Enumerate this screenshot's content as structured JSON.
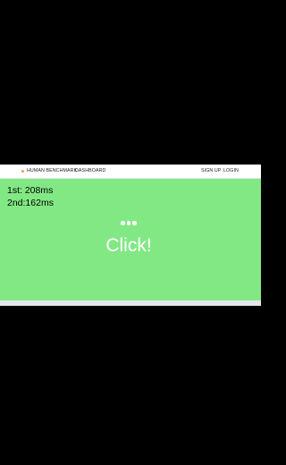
{
  "nav": {
    "brand": "HUMAN BENCHMARK",
    "dashboard": "DASHBOARD",
    "signup": "SIGN UP",
    "login": "LOGIN",
    "logo_icon": "lightning-bolt-icon"
  },
  "results": {
    "first": "1st: 208ms",
    "second": "2nd:162ms"
  },
  "test": {
    "prompt": "Click!",
    "background_color": "#82e884",
    "indicator_icon": "ellipsis-icon"
  },
  "colors": {
    "page_background": "#000000",
    "nav_background": "#ffffff",
    "text_on_green": "#ffffff"
  }
}
